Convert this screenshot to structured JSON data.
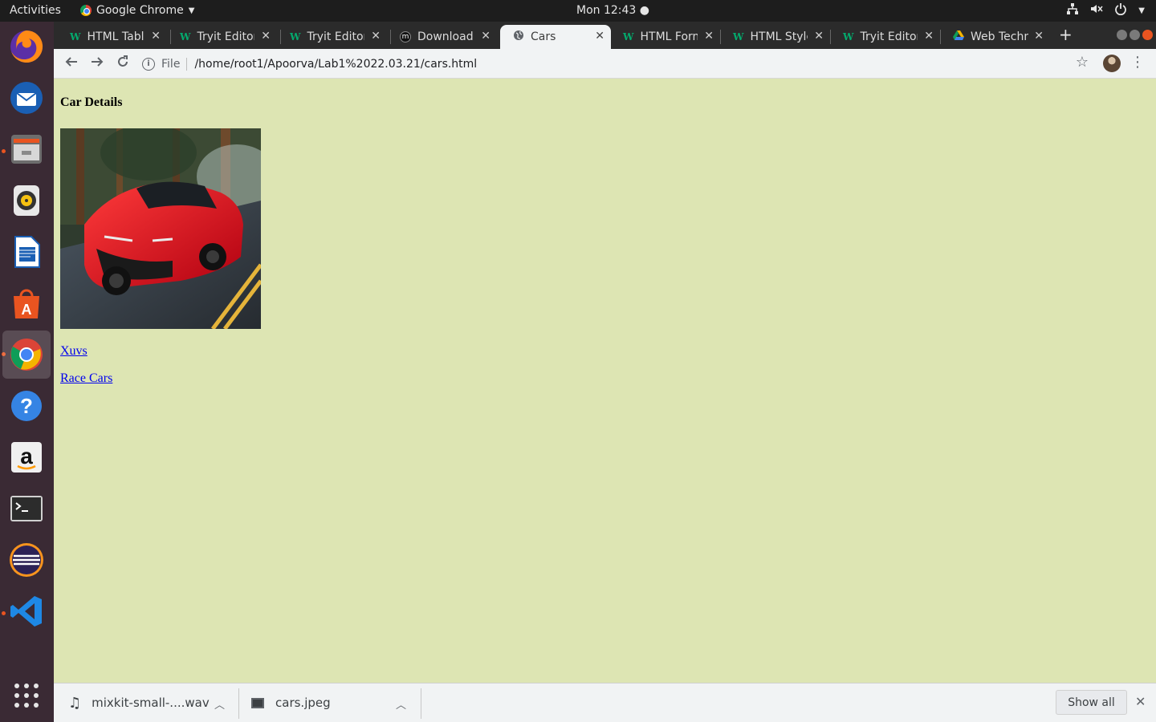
{
  "topbar": {
    "activities": "Activities",
    "app_name": "Google Chrome",
    "clock": "Mon 12:43"
  },
  "dock": {
    "items": [
      "firefox",
      "thunderbird",
      "files",
      "rhythmbox",
      "libreoffice-writer",
      "software-center",
      "chrome",
      "help",
      "amazon",
      "terminal",
      "eclipse",
      "vscode",
      "show-applications"
    ]
  },
  "tabs": [
    {
      "title": "HTML Tables",
      "icon": "w3schools-icon"
    },
    {
      "title": "Tryit Editor",
      "icon": "w3schools-icon"
    },
    {
      "title": "Tryit Editor",
      "icon": "w3schools-icon"
    },
    {
      "title": "Download",
      "icon": "mixkit-icon"
    },
    {
      "title": "Cars",
      "icon": "globe-icon",
      "active": true
    },
    {
      "title": "HTML Forms",
      "icon": "w3schools-icon"
    },
    {
      "title": "HTML Styles",
      "icon": "w3schools-icon"
    },
    {
      "title": "Tryit Editor",
      "icon": "w3schools-icon"
    },
    {
      "title": "Web Technology",
      "icon": "google-drive-icon"
    }
  ],
  "toolbar": {
    "scheme_label": "File",
    "url": "/home/root1/Apoorva/Lab1%2022.03.21/cars.html"
  },
  "page": {
    "heading": "Car Details",
    "image_alt": "red sports car",
    "links": [
      "Xuvs",
      "Race Cars"
    ]
  },
  "downloads": {
    "items": [
      {
        "name": "mixkit-small-....wav",
        "icon": "music-note-icon"
      },
      {
        "name": "cars.jpeg",
        "icon": "image-file-icon"
      }
    ],
    "show_all": "Show all"
  }
}
